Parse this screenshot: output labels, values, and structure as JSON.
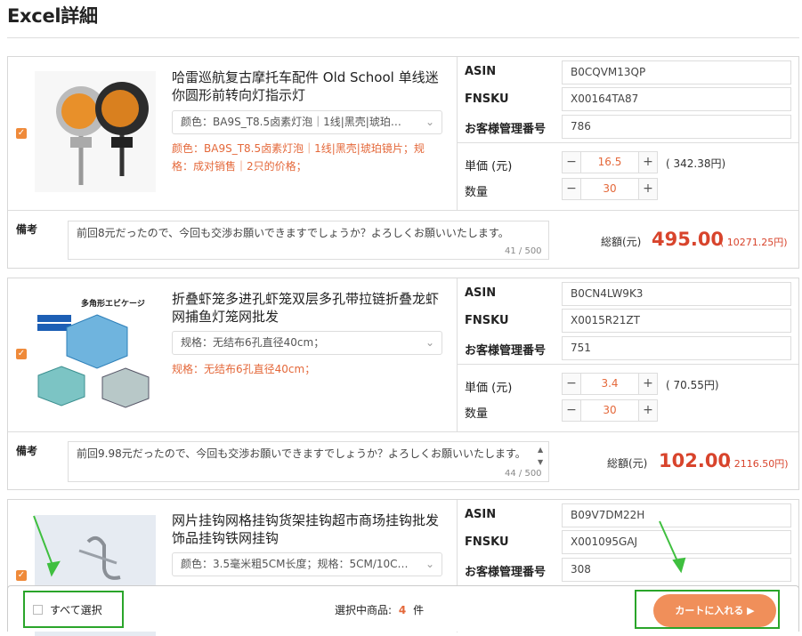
{
  "page_title": "Excel詳細",
  "fields": {
    "asin": "ASIN",
    "fnsku": "FNSKU",
    "customer_no": "お客様管理番号",
    "unit_price": "単価 (元)",
    "quantity": "数量",
    "notes": "備考",
    "total": "総額(元)"
  },
  "items": [
    {
      "name": "哈雷巡航复古摩托车配件 Old School 单线迷你圆形前转向灯指示灯",
      "variant_select": "颜色：BA9S_T8.5卤素灯泡｜1线|黑壳|琥珀…",
      "variant_text": "颜色：BA9S_T8.5卤素灯泡｜1线|黑壳|琥珀镜片；规格：成对销售｜2只的价格；",
      "asin": "B0CQVM13QP",
      "fnsku": "X00164TA87",
      "customer_no": "786",
      "unit_price": "16.5",
      "unit_price_yen": "( 342.38円)",
      "quantity": "30",
      "notes": "前回8元だったので、今回も交渉お願いできますでしょうか？よろしくお願いいたします。",
      "notes_count": "41 / 500",
      "total": "495.00",
      "total_yen": "( 10271.25円)",
      "image_caption": ""
    },
    {
      "name": "折叠虾笼多进孔虾笼双层多孔带拉链折叠龙虾网捕鱼灯笼网批发",
      "variant_select": "规格：无结布6孔直径40cm；",
      "variant_text": "规格：无结布6孔直径40cm；",
      "asin": "B0CN4LW9K3",
      "fnsku": "X0015R21ZT",
      "customer_no": "751",
      "unit_price": "3.4",
      "unit_price_yen": "( 70.55円)",
      "quantity": "30",
      "notes": "前回9.98元だったので、今回も交渉お願いできますでしょうか？よろしくお願いいたします。",
      "notes_count": "44 / 500",
      "total": "102.00",
      "total_yen": "( 2116.50円)",
      "image_caption": "多角形エビケージ"
    },
    {
      "name": "网片挂钩网格挂钩货架挂钩超市商场挂钩批发饰品挂钩铁网挂钩",
      "variant_select": "颜色：3.5毫米粗5CM长度；规格：5CM/10C…",
      "asin": "B09V7DM22H",
      "fnsku": "X001095GAJ",
      "customer_no": "308"
    }
  ],
  "bottom": {
    "select_all": "すべて選択",
    "selected_label": "選択中商品:",
    "selected_count": "4",
    "selected_unit": "件",
    "cart_button": "カートに入れる ▶"
  },
  "colors": {
    "accent": "#e4683a",
    "price_red": "#d8442c",
    "cart_button": "#f08f5a",
    "highlight_green": "#2aa52a"
  }
}
